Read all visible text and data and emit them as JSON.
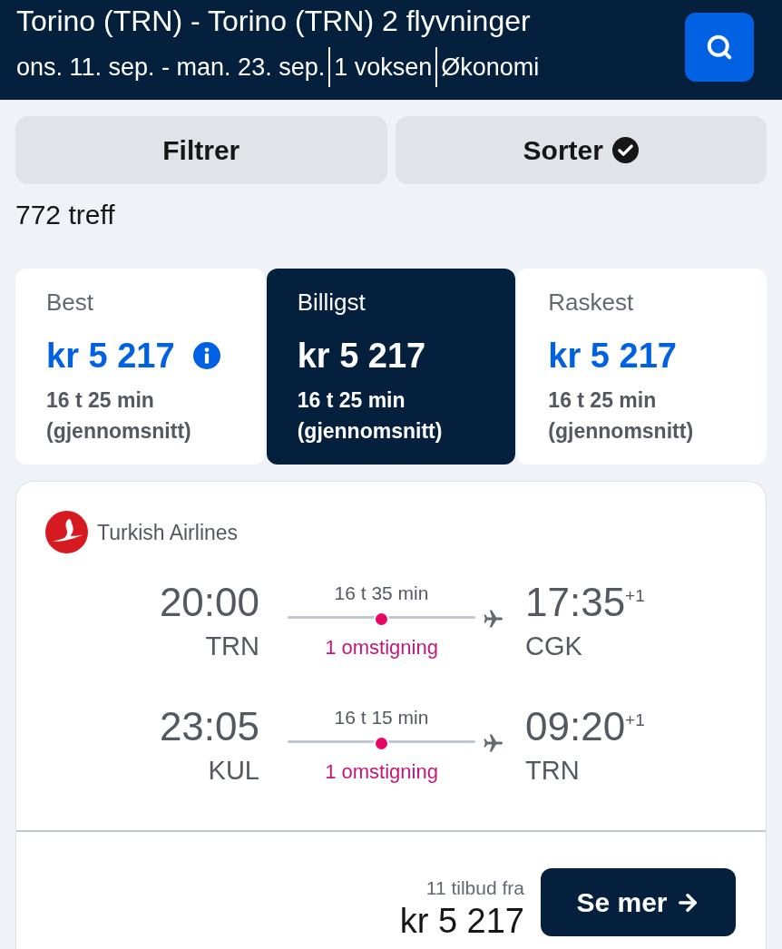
{
  "header": {
    "route": "Torino (TRN) - Torino (TRN) 2 flyvninger",
    "details": [
      "ons. 11. sep. - man. 23. sep.",
      "1 voksen",
      "Økonomi"
    ]
  },
  "actions": [
    {
      "label": "Filtrer",
      "checked": false
    },
    {
      "label": "Sorter",
      "checked": true
    }
  ],
  "result_count": "772 treff",
  "sort_tabs": [
    {
      "label": "Best",
      "price": "kr 5 217",
      "info": true,
      "duration": "16 t 25 min",
      "note": "(gjennomsnitt)",
      "selected": false
    },
    {
      "label": "Billigst",
      "price": "kr 5 217",
      "info": false,
      "duration": "16 t 25 min",
      "note": "(gjennomsnitt)",
      "selected": true
    },
    {
      "label": "Raskest",
      "price": "kr 5 217",
      "info": false,
      "duration": "16 t 25 min",
      "note": "(gjennomsnitt)",
      "selected": false
    }
  ],
  "result": {
    "airline": "Turkish Airlines",
    "legs": [
      {
        "depart_time": "20:00",
        "depart_airport": "TRN",
        "duration": "16 t 35 min",
        "stops": "1 omstigning",
        "arrive_time": "17:35",
        "day_offset": "+1",
        "arrive_airport": "CGK"
      },
      {
        "depart_time": "23:05",
        "depart_airport": "KUL",
        "duration": "16 t 15 min",
        "stops": "1 omstigning",
        "arrive_time": "09:20",
        "day_offset": "+1",
        "arrive_airport": "TRN"
      }
    ],
    "offers": "11 tilbud fra",
    "price": "kr 5 217",
    "button": "Se mer"
  }
}
